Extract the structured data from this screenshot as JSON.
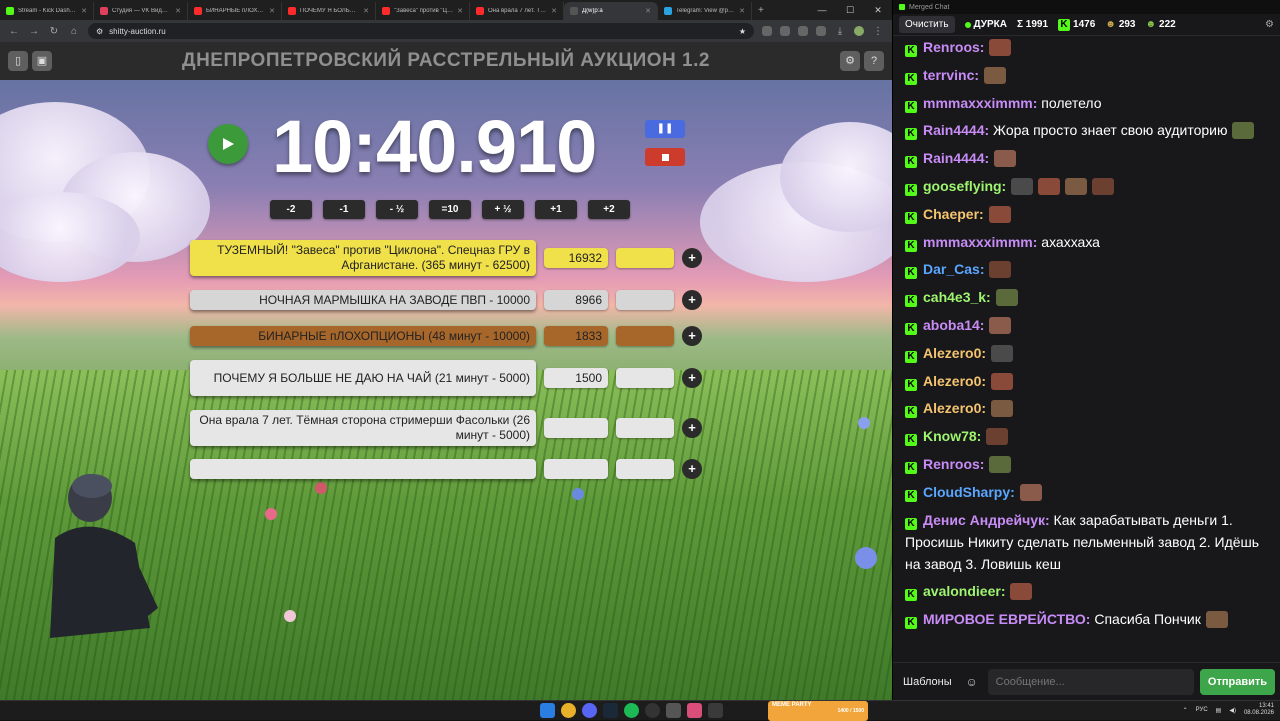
{
  "browser": {
    "tabs": [
      {
        "title": "Stream - Kick Dashboard",
        "color": "#53fc18",
        "active": false
      },
      {
        "title": "Студия — VK Видео Live",
        "color": "#e0405c",
        "active": false
      },
      {
        "title": "БИНАРНЫЕ пЛОХОПЦИОНЫ",
        "color": "#ff2a2a",
        "active": false
      },
      {
        "title": "ПОЧЕМУ Я БОЛЬШЕ НЕ ДАЮ",
        "color": "#ff2a2a",
        "active": false
      },
      {
        "title": "\"Завеса\" против \"Циклона\"",
        "color": "#ff2a2a",
        "active": false
      },
      {
        "title": "Она врала 7 лет. Тёмная",
        "color": "#ff2a2a",
        "active": false
      },
      {
        "title": "Д(w)р:а",
        "color": "#555555",
        "active": true
      },
      {
        "title": "Telegram: View @podvodsi",
        "color": "#2aa3e0",
        "active": false
      }
    ],
    "new_tab": "+",
    "url": "shitty-auction.ru"
  },
  "app": {
    "title": "ДНЕПРОПЕТРОВСКИЙ РАССТРЕЛЬНЫЙ АУКЦИОН 1.2",
    "timer": "10:40.910",
    "adjust_buttons": [
      "-2",
      "-1",
      "- ½",
      "=10",
      "+ ½",
      "+1",
      "+2"
    ],
    "lots": [
      {
        "name": "ТУЗЕМНЫЙ! \"Завеса\" против \"Циклона\". Спецназ ГРУ в Афганистане. (365 минут - 62500)",
        "amount": "16932",
        "color": "#f0e04a"
      },
      {
        "name": "НОЧНАЯ МАРМЫШКА НА ЗАВОДЕ ПВП - 10000",
        "amount": "8966",
        "color": "#d6d6d6"
      },
      {
        "name": "БИНАРНЫЕ пЛОХОПЦИОНЫ (48 минут - 10000)",
        "amount": "1833",
        "color": "#a8672a"
      },
      {
        "name": "ПОЧЕМУ Я БОЛЬШЕ НЕ ДАЮ НА ЧАЙ (21 минут - 5000)",
        "amount": "1500",
        "color": "#e6e6e6"
      },
      {
        "name": "Она врала 7 лет. Тёмная сторона стримерши Фасольки (26 минут - 5000)",
        "amount": "",
        "color": "#e6e6e6"
      },
      {
        "name": "",
        "amount": "",
        "color": "#e6e6e6"
      }
    ],
    "plus_label": "+"
  },
  "chat": {
    "window_title": "Merged Chat",
    "clear_label": "Очистить",
    "channel": "ДУРКА",
    "sum": "Σ 1991",
    "kick_count": "1476",
    "count2": "293",
    "count3": "222",
    "messages": [
      {
        "user": "Renroos:",
        "color": "#c78cf5",
        "text": "",
        "emotes": 1
      },
      {
        "user": "terrvinc:",
        "color": "#c78cf5",
        "text": "",
        "emotes": 1
      },
      {
        "user": "mmmaxxximmm:",
        "color": "#c78cf5",
        "text": " полетело",
        "emotes": 0
      },
      {
        "user": "Rain4444:",
        "color": "#c78cf5",
        "text": " Жора просто знает свою аудиторию",
        "emotes": 1
      },
      {
        "user": "Rain4444:",
        "color": "#c78cf5",
        "text": "",
        "emotes": 1
      },
      {
        "user": "gooseflying:",
        "color": "#9ef56e",
        "text": "",
        "emotes": 4
      },
      {
        "user": "Chaeper:",
        "color": "#f5c46e",
        "text": "",
        "emotes": 1
      },
      {
        "user": "mmmaxxximmm:",
        "color": "#c78cf5",
        "text": " ахаххаха",
        "emotes": 0
      },
      {
        "user": "Dar_Cas:",
        "color": "#5aa6ff",
        "text": "",
        "emotes": 1
      },
      {
        "user": "cah4e3_k:",
        "color": "#9ef56e",
        "text": "",
        "emotes": 1
      },
      {
        "user": "aboba14:",
        "color": "#c78cf5",
        "text": "",
        "emotes": 1
      },
      {
        "user": "Alezero0:",
        "color": "#f5c46e",
        "text": "",
        "emotes": 1
      },
      {
        "user": "Alezero0:",
        "color": "#f5c46e",
        "text": "",
        "emotes": 1
      },
      {
        "user": "Alezero0:",
        "color": "#f5c46e",
        "text": "",
        "emotes": 1
      },
      {
        "user": "Know78:",
        "color": "#9ef56e",
        "text": "",
        "emotes": 1
      },
      {
        "user": "Renroos:",
        "color": "#c78cf5",
        "text": "",
        "emotes": 1
      },
      {
        "user": "CloudSharpy:",
        "color": "#5aa6ff",
        "text": "",
        "emotes": 1
      },
      {
        "user": "Денис Андрейчук:",
        "color": "#c78cf5",
        "text": " Как зарабатывать деньги 1. Просишь Никиту сделать пельменный завод 2. Идёшь на завод 3. Ловишь кеш",
        "emotes": 0
      },
      {
        "user": "avalondieer:",
        "color": "#9ef56e",
        "text": "",
        "emotes": 1
      },
      {
        "user": "МИРОВОЕ ЕВРЕЙСТВО:",
        "color": "#c78cf5",
        "text": " Спасиба Пончик",
        "emotes": 1
      }
    ],
    "templates_label": "Шаблоны",
    "input_placeholder": "Сообщение...",
    "send_label": "Отправить"
  },
  "taskbar": {
    "widget": "MEME PARTY",
    "widget_sub": "1400 / 1500",
    "lang": "РУС",
    "time": "13:41",
    "date": "08.08.2026"
  }
}
